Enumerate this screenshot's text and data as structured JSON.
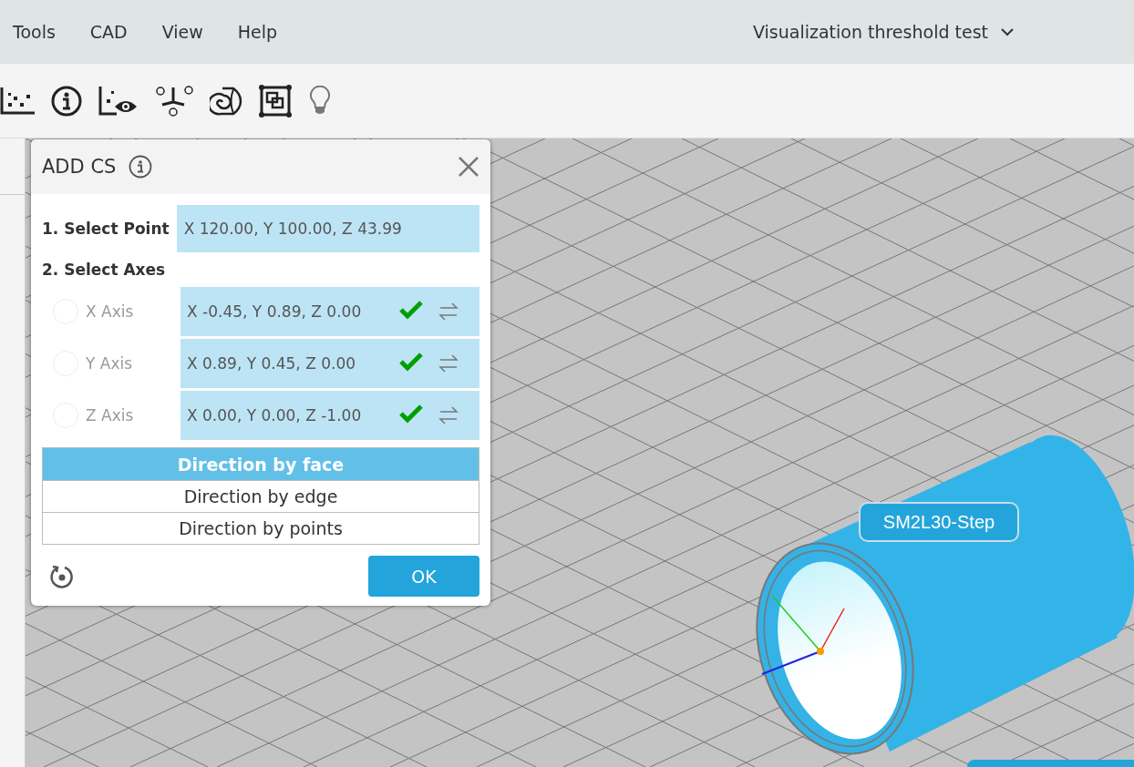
{
  "menu": [
    {
      "label": "Tools"
    },
    {
      "label": "CAD"
    },
    {
      "label": "View"
    },
    {
      "label": "Help"
    }
  ],
  "project": {
    "title": "Visualization threshold test"
  },
  "toolbar": [
    {
      "kind": "scatter"
    },
    {
      "kind": "info"
    },
    {
      "kind": "scatter-eye"
    },
    {
      "kind": "nodes"
    },
    {
      "kind": "roll"
    },
    {
      "kind": "frame"
    },
    {
      "kind": "bulb",
      "disabled": true
    }
  ],
  "dialog": {
    "title": "ADD CS",
    "point": {
      "label": "1. Select Point",
      "value": "X 120.00, Y 100.00, Z 43.99"
    },
    "axes_label": "2. Select Axes",
    "axes": [
      {
        "label": "X Axis",
        "selected": false,
        "value": "X -0.45, Y 0.89, Z 0.00",
        "confirmed": true
      },
      {
        "label": "Y Axis",
        "selected": false,
        "value": "X 0.89, Y 0.45, Z 0.00",
        "confirmed": true
      },
      {
        "label": "Z Axis",
        "selected": false,
        "value": "X 0.00, Y 0.00, Z -1.00",
        "confirmed": true
      }
    ],
    "modes": [
      {
        "label": "Direction by face",
        "selected": true
      },
      {
        "label": "Direction by edge",
        "selected": false
      },
      {
        "label": "Direction by points",
        "selected": false
      }
    ],
    "ok": "OK"
  },
  "model_label": "SM2L30-Step"
}
